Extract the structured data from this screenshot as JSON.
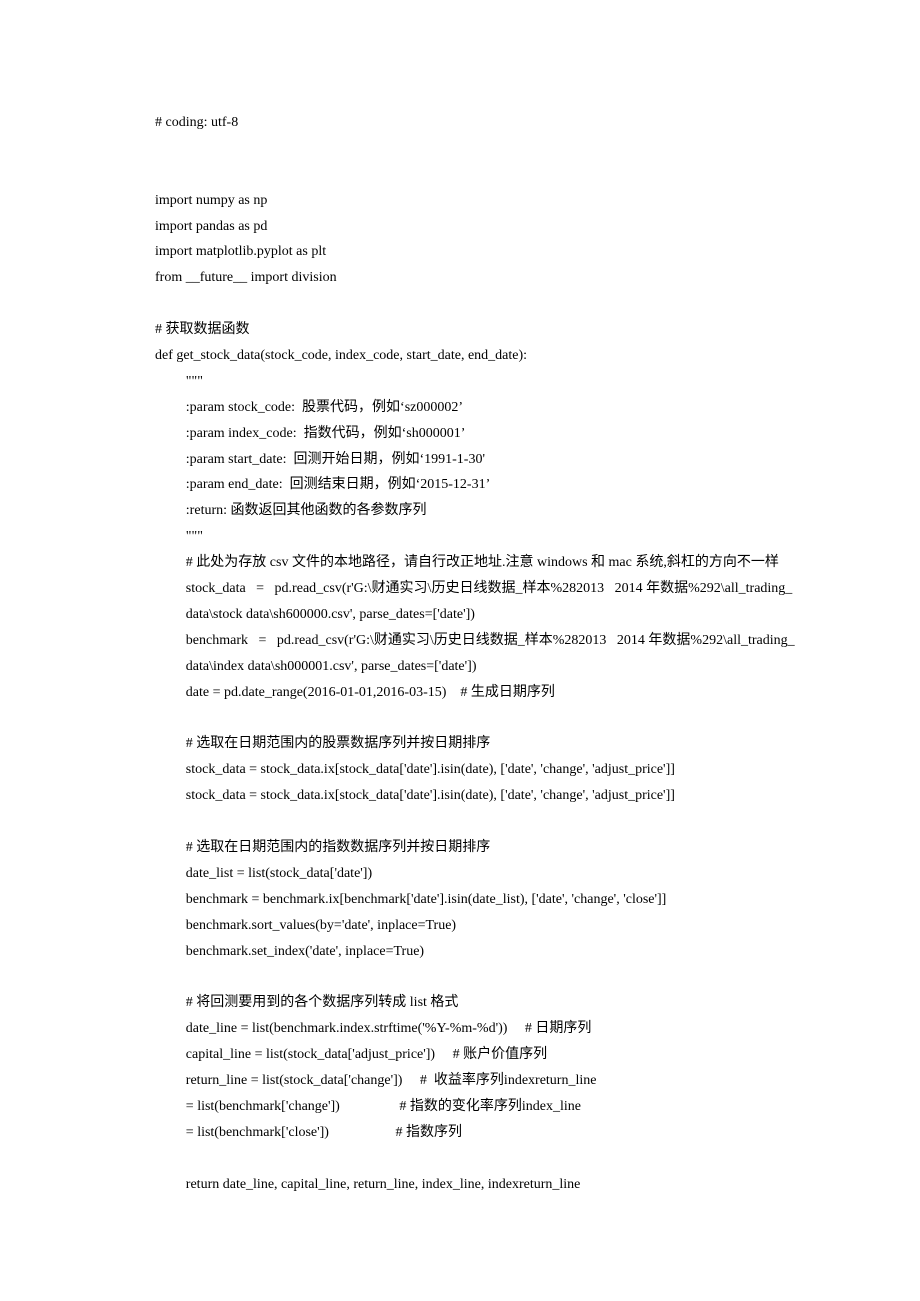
{
  "lines": [
    {
      "cls": "",
      "t": "# coding: utf-8"
    },
    {
      "blank": true
    },
    {
      "blank": true
    },
    {
      "cls": "",
      "t": "import numpy as np"
    },
    {
      "cls": "",
      "t": "import pandas as pd"
    },
    {
      "cls": "",
      "t": "import matplotlib.pyplot as plt"
    },
    {
      "cls": "",
      "t": "from __future__ import division"
    },
    {
      "blank": true
    },
    {
      "cls": "",
      "t": "# 获取数据函数"
    },
    {
      "cls": "",
      "t": "def get_stock_data(stock_code, index_code, start_date, end_date):"
    },
    {
      "cls": "indent1",
      "t": "\"\"\""
    },
    {
      "cls": "indent1",
      "t": ":param stock_code:  股票代码，例如‘sz000002’"
    },
    {
      "cls": "indent1",
      "t": ":param index_code:  指数代码，例如‘sh000001’"
    },
    {
      "cls": "indent1",
      "t": ":param start_date:  回测开始日期，例如‘1991-1-30'"
    },
    {
      "cls": "indent1",
      "t": ":param end_date:  回测结束日期，例如‘2015-12-31’"
    },
    {
      "cls": "indent1",
      "t": ":return: 函数返回其他函数的各参数序列"
    },
    {
      "cls": "indent1",
      "t": "\"\"\""
    },
    {
      "cls": "indent1",
      "t": "# 此处为存放 csv 文件的本地路径，请自行改正地址.注意 windows 和 mac 系统,斜杠的方向不一样"
    },
    {
      "cls": "indent1",
      "t": "stock_data   =   pd.read_csv(r'G:\\财通实习\\历史日线数据_样本%282013   2014 年数据%292\\all_trading_data\\stock data\\sh600000.csv', parse_dates=['date'])"
    },
    {
      "cls": "indent1",
      "t": "benchmark   =   pd.read_csv(r'G:\\财通实习\\历史日线数据_样本%282013   2014 年数据%292\\all_trading_data\\index data\\sh000001.csv', parse_dates=['date'])"
    },
    {
      "cls": "indent1",
      "t": "date = pd.date_range(2016-01-01,2016-03-15)    # 生成日期序列"
    },
    {
      "blank": true
    },
    {
      "cls": "indent1",
      "t": "# 选取在日期范围内的股票数据序列并按日期排序"
    },
    {
      "cls": "indent1",
      "t": "stock_data = stock_data.ix[stock_data['date'].isin(date), ['date', 'change', 'adjust_price']]"
    },
    {
      "cls": "indent1",
      "t": "stock_data = stock_data.ix[stock_data['date'].isin(date), ['date', 'change', 'adjust_price']]"
    },
    {
      "blank": true
    },
    {
      "cls": "indent1",
      "t": "# 选取在日期范围内的指数数据序列并按日期排序"
    },
    {
      "cls": "indent1",
      "t": "date_list = list(stock_data['date'])"
    },
    {
      "cls": "indent1",
      "t": "benchmark = benchmark.ix[benchmark['date'].isin(date_list), ['date', 'change', 'close']]"
    },
    {
      "cls": "indent1",
      "t": "benchmark.sort_values(by='date', inplace=True)"
    },
    {
      "cls": "indent1",
      "t": "benchmark.set_index('date', inplace=True)"
    },
    {
      "blank": true
    },
    {
      "cls": "indent1",
      "t": "# 将回测要用到的各个数据序列转成 list 格式"
    },
    {
      "cls": "indent1",
      "t": "date_line = list(benchmark.index.strftime('%Y-%m-%d'))     # 日期序列"
    },
    {
      "cls": "indent1",
      "t": "capital_line = list(stock_data['adjust_price'])     # 账户价值序列"
    },
    {
      "cls": "indent1",
      "t": "return_line = list(stock_data['change'])     #  收益率序列indexreturn_line"
    },
    {
      "cls": "indent1",
      "t": "= list(benchmark['change'])                 # 指数的变化率序列index_line"
    },
    {
      "cls": "indent1",
      "t": "= list(benchmark['close'])                   # 指数序列"
    },
    {
      "blank": true
    },
    {
      "cls": "indent1",
      "t": "return date_line, capital_line, return_line, index_line, indexreturn_line"
    }
  ]
}
